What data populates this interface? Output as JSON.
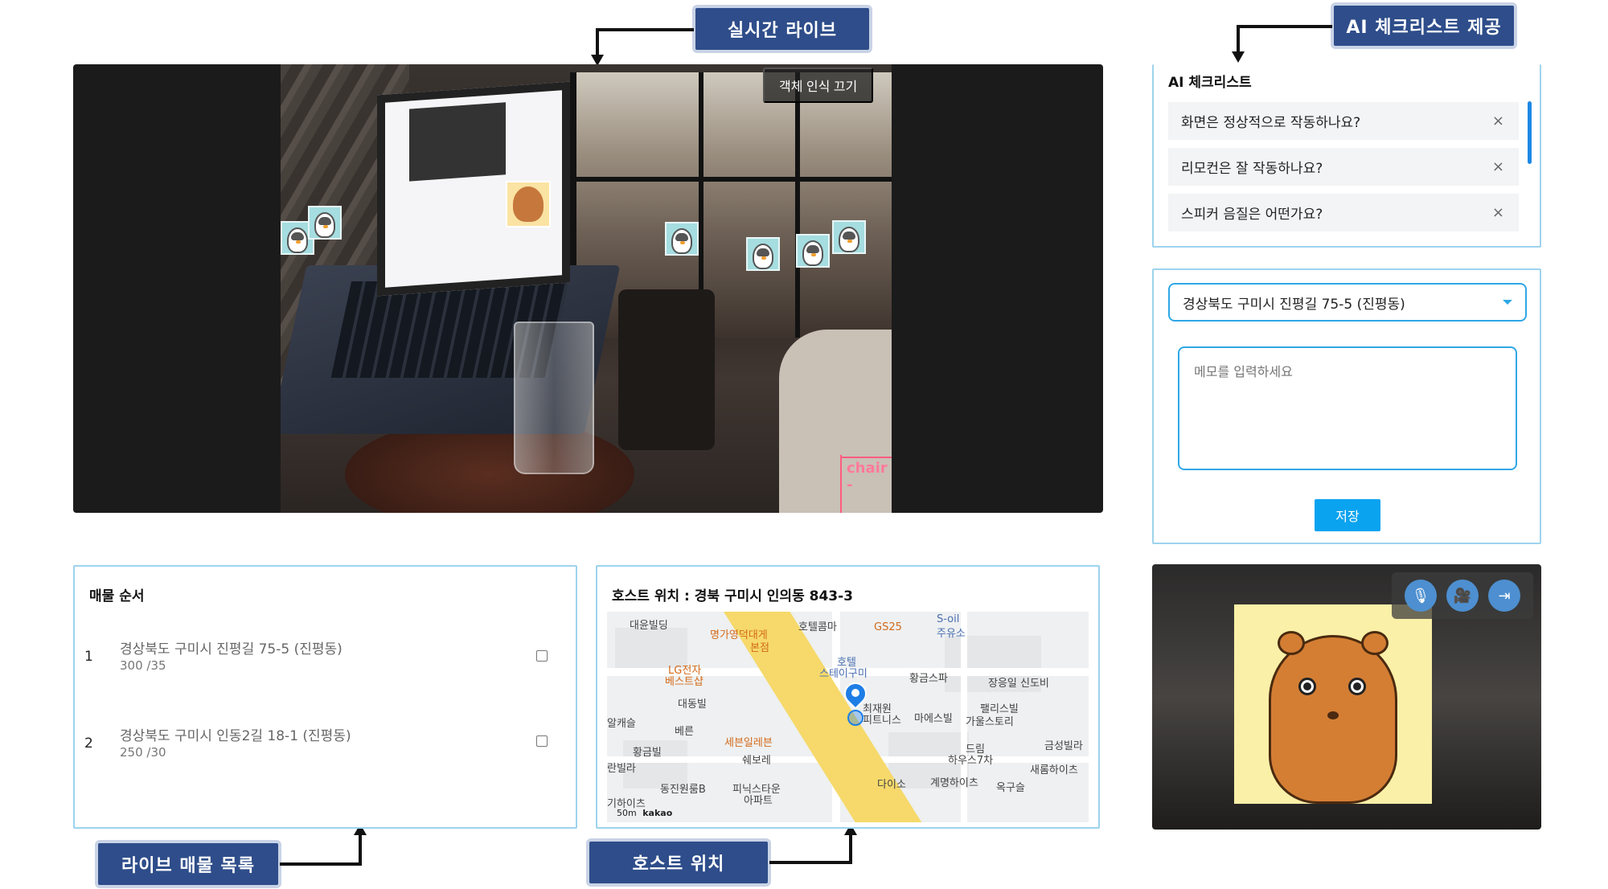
{
  "callouts": {
    "live": "실시간 라이브",
    "checklist": "AI 체크리스트 제공",
    "list": "라이브 매물 목록",
    "host_location": "호스트 위치"
  },
  "video": {
    "object_toggle": "객체 인식 끄기",
    "detection_label": "chair -"
  },
  "checklist": {
    "title": "AI 체크리스트",
    "items": [
      {
        "text": "화면은 정상적으로 작동하나요?",
        "close": "×"
      },
      {
        "text": "리모컨은 잘 작동하나요?",
        "close": "×"
      },
      {
        "text": "스피커 음질은 어떤가요?",
        "close": "×"
      }
    ]
  },
  "memo": {
    "selected_address": "경상북도 구미시 진평길 75-5 (진평동)",
    "placeholder": "메모를 입력하세요",
    "save_label": "저장"
  },
  "host_cam": {
    "mic_icon": "🎙",
    "video_icon": "🎥",
    "exit_icon": "⇥"
  },
  "order": {
    "title": "매물 순서",
    "rows": [
      {
        "num": "1",
        "address": "경상북도 구미시 진평길 75-5 (진평동)",
        "price": "300 /35"
      },
      {
        "num": "2",
        "address": "경상북도 구미시 인동2길 18-1 (진평동)",
        "price": "250 /30"
      }
    ]
  },
  "location": {
    "title": "호스트 위치 : 경북 구미시 인의동 843-3",
    "map_labels": {
      "l1": "대윤빌딩",
      "l2": "명가영덕대게",
      "l2b": "본점",
      "l3": "호텔콤마",
      "l4": "GS25",
      "l5": "S-oil",
      "l5b": "주유소",
      "l6": "LG전자",
      "l6b": "베스트샵",
      "l7": "호텔",
      "l7b": "스테이구미",
      "l8": "황금스파",
      "l9": "장응일 신도비",
      "l10": "대동빌",
      "l11": "최재원",
      "l11b": "피트니스",
      "l12": "마에스빌",
      "l13": "팰리스빌",
      "l13b": "가울스토리",
      "l14": "알캐슬",
      "l15": "베른",
      "l16": "세븐일레븐",
      "l17": "황금빌",
      "l18": "쉐보레",
      "l19": "드림",
      "l19b": "하우스7차",
      "l20": "금성빌라",
      "l21": "란빌라",
      "l22": "새롬하이츠",
      "l23": "동진원룸B",
      "l24": "피닉스타운",
      "l24b": "아파트",
      "l25": "다이소",
      "l26": "계명하이츠",
      "l27": "옥구슬",
      "l28": "기하이츠",
      "scale": "50m",
      "brand": "kakao"
    }
  }
}
